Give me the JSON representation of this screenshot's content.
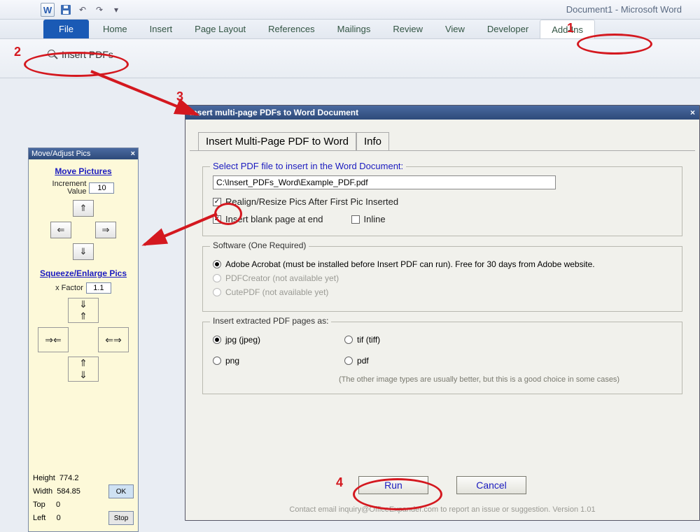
{
  "window": {
    "doc_title": "Document1  -  Microsoft Word",
    "app_letter": "W"
  },
  "ribbon": {
    "tabs": [
      "File",
      "Home",
      "Insert",
      "Page Layout",
      "References",
      "Mailings",
      "Review",
      "View",
      "Developer",
      "Add-Ins"
    ],
    "active_tab": "Add-Ins",
    "insert_pdfs_label": "Insert PDFs"
  },
  "palette": {
    "title": "Move/Adjust Pics",
    "move_header": "Move Pictures",
    "increment_label": "Increment",
    "value_label": "Value",
    "increment_value": "10",
    "squeeze_header": "Squeeze/Enlarge Pics",
    "xfactor_label": "x Factor",
    "xfactor_value": "1.1",
    "height_label": "Height",
    "height_value": "774.2",
    "width_label": "Width",
    "width_value": "584.85",
    "top_label": "Top",
    "top_value": "0",
    "left_label": "Left",
    "left_value": "0",
    "ok_label": "OK",
    "stop_label": "Stop"
  },
  "dialog": {
    "title": "Insert multi-page PDFs to Word Document",
    "tab1": "Insert Multi-Page PDF to Word",
    "tab2": "Info",
    "select_legend": "Select PDF file to insert in the Word Document:",
    "path_value": "C:\\Insert_PDFs_Word\\Example_PDF.pdf",
    "realign_label": "Realign/Resize Pics After First Pic Inserted",
    "blank_label": "Insert blank page at end",
    "inline_label": "Inline",
    "software_legend": "Software (One Required)",
    "adobe_label": "Adobe Acrobat (must be installed before Insert PDF can run).  Free for 30 days from Adobe website.",
    "pdfcreator_label": "PDFCreator (not available yet)",
    "cutepdf_label": "CutePDF (not available yet)",
    "format_legend": "Insert extracted PDF pages as:",
    "jpg_label": "jpg (jpeg)",
    "tif_label": "tif (tiff)",
    "png_label": "png",
    "pdf_label": "pdf",
    "format_note": "(The other image types are usually better, but this is a good choice in some cases)",
    "run_label": "Run",
    "cancel_label": "Cancel",
    "footer": "Contact email inquiry@OfficeExpander.com to report an issue or suggestion.   Version 1.01"
  },
  "annotations": {
    "n1": "1",
    "n2": "2",
    "n3": "3",
    "n4": "4"
  }
}
